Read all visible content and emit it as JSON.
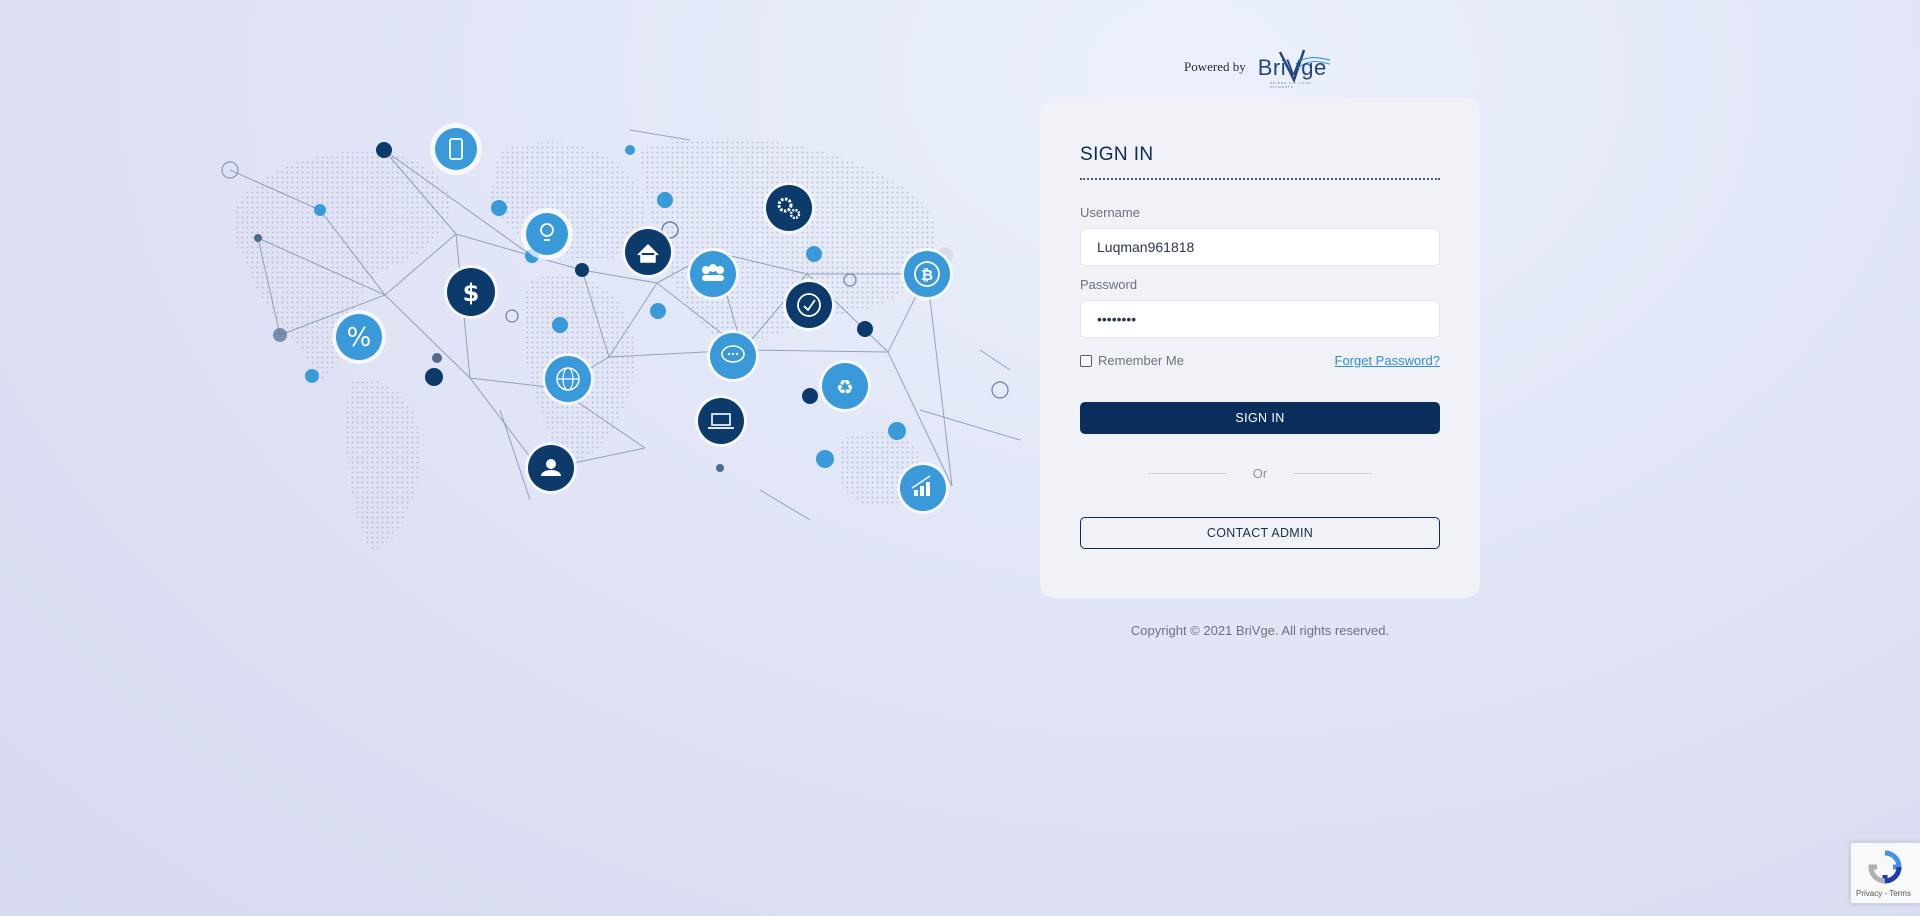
{
  "header": {
    "powered_by": "Powered by",
    "brand_name": "BriVge",
    "brand_tagline": "BRIDGE ALL YOUR PAYMENTS"
  },
  "login": {
    "title": "SIGN IN",
    "username_label": "Username",
    "username_value": "Luqman961818",
    "password_label": "Password",
    "password_value": "••••••••",
    "remember_label": "Remember Me",
    "remember_checked": false,
    "forget_label": "Forget Password?",
    "signin_button": "SIGN IN",
    "or_text": "Or",
    "contact_button": "CONTACT ADMIN"
  },
  "footer": {
    "copyright": "Copyright © 2021 BriVge. All rights reserved."
  },
  "recaptcha": {
    "links": "Privacy - Terms"
  },
  "illustration": {
    "icons": [
      "phone-icon",
      "bulb-icon",
      "home-icon",
      "people-icon",
      "gear-icon",
      "bitcoin-icon",
      "percent-icon",
      "dollar-icon",
      "globe-icon",
      "clock-icon",
      "chat-icon",
      "recycle-icon",
      "laptop-icon",
      "user-icon",
      "chart-icon"
    ]
  },
  "colors": {
    "primary": "#092e5b",
    "accent_light": "#3a9ad9",
    "accent_dark": "#0b3a6b",
    "link": "#2f8fd3",
    "card_bg": "#f1f2f8"
  }
}
